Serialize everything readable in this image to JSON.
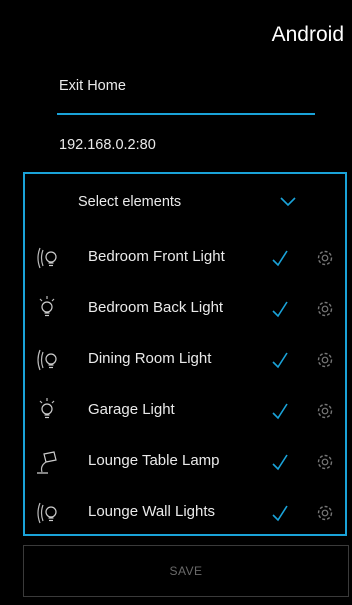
{
  "os_label": "Android",
  "form": {
    "name_value": "Exit Home",
    "address_value": "192.168.0.2:80"
  },
  "panel": {
    "select_label": "Select elements",
    "items": [
      {
        "label": "Bedroom Front Light",
        "icon": "bulb-icon",
        "selected": true
      },
      {
        "label": "Bedroom Back Light",
        "icon": "bulb-icon",
        "selected": true
      },
      {
        "label": "Dining Room Light",
        "icon": "bulb-icon",
        "selected": true
      },
      {
        "label": "Garage Light",
        "icon": "bulb-icon",
        "selected": true
      },
      {
        "label": "Lounge Table Lamp",
        "icon": "table-lamp-icon",
        "selected": true
      },
      {
        "label": "Lounge Wall Lights",
        "icon": "bulb-icon",
        "selected": true
      }
    ]
  },
  "save_label": "SAVE",
  "colors": {
    "accent": "#1aa3d9",
    "background": "#000000"
  }
}
